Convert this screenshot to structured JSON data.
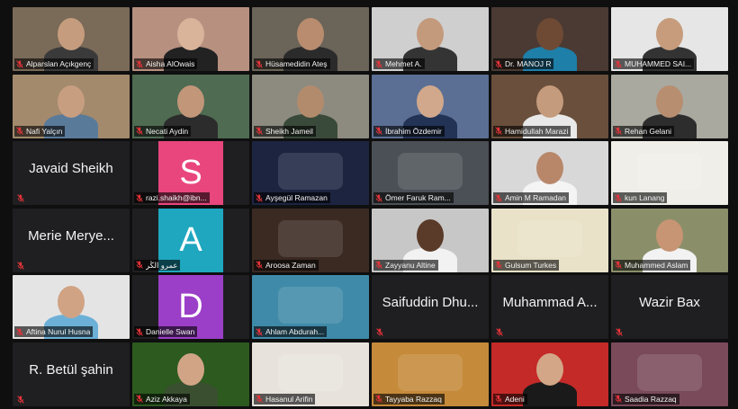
{
  "tiles": [
    {
      "name": "Alparslan Açıkgenç",
      "type": "video",
      "bg": "#7a6a58",
      "skin": "#c59d7e",
      "shirt": "#3a3a3a"
    },
    {
      "name": "Aisha AlOwais",
      "type": "video",
      "bg": "#b89080",
      "skin": "#d9b39a",
      "shirt": "#222222"
    },
    {
      "name": "Hüsamedidin Ateş",
      "type": "video",
      "bg": "#6b6458",
      "skin": "#b98c6f",
      "shirt": "#2b2b2b"
    },
    {
      "name": "Mehmet A.",
      "type": "video",
      "bg": "#cfcfcf",
      "skin": "#c49a7c",
      "shirt": "#343434"
    },
    {
      "name": "Dr. MANOJ R",
      "type": "video",
      "bg": "#4a3a33",
      "skin": "#6e4a35",
      "shirt": "#1e7fa8"
    },
    {
      "name": "MUHAMMED SAI...",
      "type": "video",
      "bg": "#e6e6e6",
      "skin": "#c69c7c",
      "shirt": "#333333"
    },
    {
      "name": "Nafi Yalçın",
      "type": "video",
      "bg": "#a38a6c",
      "skin": "#c79e80",
      "shirt": "#5a7a9a"
    },
    {
      "name": "Necati Aydin",
      "type": "video",
      "bg": "#4f6b52",
      "skin": "#c29679",
      "shirt": "#2c2c2c",
      "active": true
    },
    {
      "name": "Sheikh Jameil",
      "type": "video",
      "bg": "#8d8b80",
      "skin": "#b28b6d",
      "shirt": "#3a4a3a"
    },
    {
      "name": "İbrahim Özdemir",
      "type": "video",
      "bg": "#5b6f94",
      "skin": "#d1a88b",
      "shirt": "#223355"
    },
    {
      "name": "Hamidullah Marazi",
      "type": "video",
      "bg": "#6a4f3c",
      "skin": "#c49b7c",
      "shirt": "#e8e8e8"
    },
    {
      "name": "Rehan Gelani",
      "type": "video",
      "bg": "#a9a9a0",
      "skin": "#b88e70",
      "shirt": "#2d2d2d"
    },
    {
      "name": "Javaid Sheikh",
      "type": "name"
    },
    {
      "name": "razi.shaikh@ibn...",
      "type": "letter",
      "letter": "S",
      "color": "#e8467c"
    },
    {
      "name": "Ayşegül Ramazan",
      "type": "image",
      "bg": "#1c2440"
    },
    {
      "name": "Ömer Faruk Ram...",
      "type": "image",
      "bg": "#4a5056"
    },
    {
      "name": "Amin M Ramadan",
      "type": "video",
      "bg": "#d8d8d8",
      "skin": "#b8876a",
      "shirt": "#f4f4f4"
    },
    {
      "name": "kun Lanang",
      "type": "image",
      "bg": "#f0eee8"
    },
    {
      "name": "Merie Merye...",
      "type": "name"
    },
    {
      "name": "عمرو الڭر",
      "type": "letter",
      "letter": "A",
      "color": "#1fa7bf"
    },
    {
      "name": "Aroosa Zaman",
      "type": "image",
      "bg": "#3a2a22"
    },
    {
      "name": "Zayyanu Altine",
      "type": "video",
      "bg": "#c7c7c7",
      "skin": "#5a3a28",
      "shirt": "#f2f2f2"
    },
    {
      "name": "Gulsum Turkes",
      "type": "image",
      "bg": "#e9e2c8"
    },
    {
      "name": "Muhammed Aslam",
      "type": "video",
      "bg": "#8a8f6a",
      "skin": "#c79574",
      "shirt": "#f2f2f2"
    },
    {
      "name": "Aftina Nurul Husna",
      "type": "video",
      "bg": "#e4e4e4",
      "skin": "#d0a384",
      "shirt": "#6cb0d8"
    },
    {
      "name": "Danielle Swan",
      "type": "letter",
      "letter": "D",
      "color": "#9b3fc8"
    },
    {
      "name": "Ahlam Abdurah...",
      "type": "image",
      "bg": "#3f8aa8"
    },
    {
      "name": "Saifuddin Dhu...",
      "type": "name"
    },
    {
      "name": "Muhammad A...",
      "type": "name"
    },
    {
      "name": "Wazir Bax",
      "type": "name"
    },
    {
      "name": "R. Betül şahin",
      "type": "name"
    },
    {
      "name": "Aziz Akkaya",
      "type": "video",
      "bg": "#2c5a1f",
      "skin": "#d1a486",
      "shirt": "#3a4f30"
    },
    {
      "name": "Hasanul Arifin",
      "type": "image",
      "bg": "#e7e3dc"
    },
    {
      "name": "Tayyaba Razzaq",
      "type": "image",
      "bg": "#c58a3a"
    },
    {
      "name": "Adeni",
      "type": "video",
      "bg": "#c42a28",
      "skin": "#d3a687",
      "shirt": "#1a1a1a"
    },
    {
      "name": "Saadia Razzaq",
      "type": "image",
      "bg": "#7a4a5a"
    }
  ],
  "colors": {
    "muted": "#e5343a",
    "active_border": "#d9e04b"
  },
  "icons": {
    "mic": "mic-muted-icon"
  }
}
